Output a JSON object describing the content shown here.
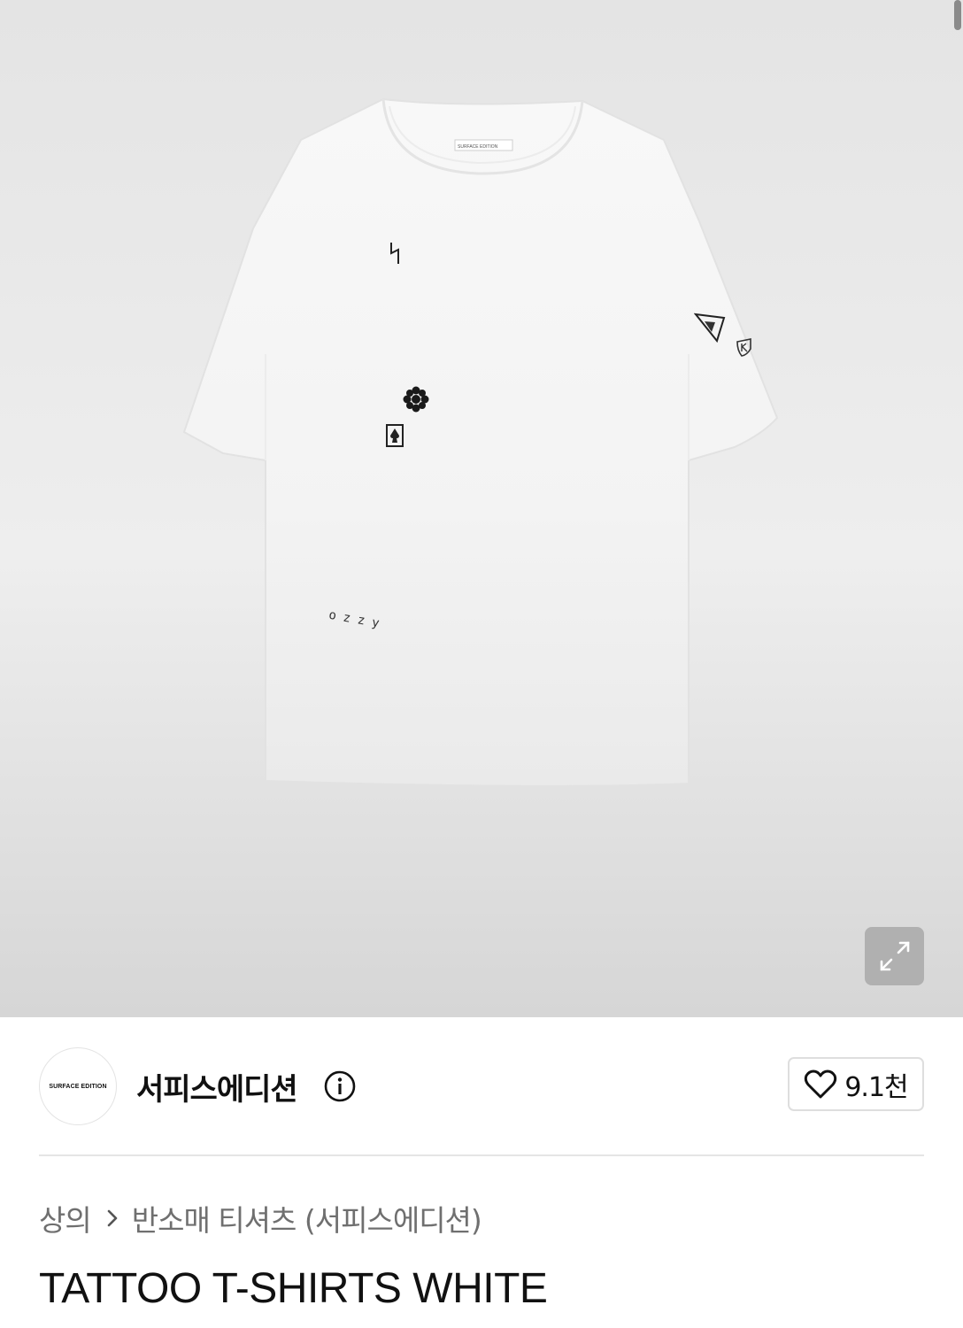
{
  "hero": {
    "label_text": "SURFACE EDITION",
    "print_text": "ozzy"
  },
  "brand": {
    "logo_text": "SURFACE EDITION",
    "name": "서피스에디션",
    "like_count": "9.1천"
  },
  "breadcrumb": {
    "items": [
      "상의",
      "반소매 티셔츠 (서피스에디션)"
    ]
  },
  "product": {
    "title": "TATTOO T-SHIRTS WHITE"
  },
  "icons": [
    "expand-icon",
    "info-icon",
    "heart-icon",
    "chevron-right-icon"
  ],
  "colors": {
    "background": "#ffffff",
    "hero_background": "#e6e6e6",
    "text_primary": "#111111",
    "text_secondary": "#6f6f6f",
    "border": "#dedede"
  }
}
